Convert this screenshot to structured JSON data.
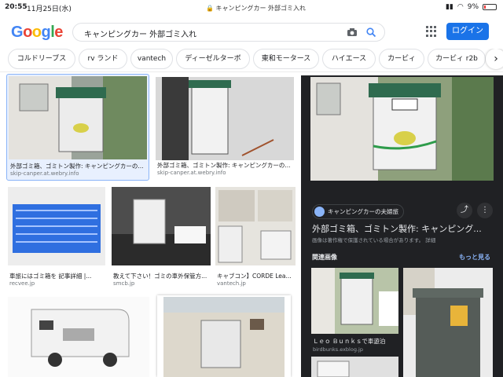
{
  "status_bar": {
    "time": "20:55",
    "date": "11月25日(水)",
    "url": "キャンピングカー 外部ゴミ入れ",
    "battery": "9%"
  },
  "header": {
    "logo": {
      "G": "G",
      "o1": "o",
      "o2": "o",
      "g": "g",
      "l": "l",
      "e": "e"
    },
    "query": "キャンピングカー 外部ゴミ入れ",
    "login": "ログイン"
  },
  "chips": [
    "コルドリーブス",
    "rv ランド",
    "vantech",
    "ディーゼルターボ",
    "東和モータース",
    "ハイエース",
    "カービィ",
    "カービィ r2b"
  ],
  "results": [
    {
      "caption": "外部ゴミ箱、ゴミトン製作: キャンピングカーの...",
      "source": "skip-canper.at.webry.info"
    },
    {
      "caption": "外部ゴミ箱、ゴミトン製作: キャンピングカーの...",
      "source": "skip-canper.at.webry.info"
    },
    {
      "caption": "車旅にはゴミ箱を 記事詳細 |...",
      "source": "recvee.jp"
    },
    {
      "caption": "教えて下さい！ゴミの車外保管方...",
      "source": "smcb.jp"
    },
    {
      "caption": "キャブコン】CORDE Lea...",
      "source": "vantech.jp"
    }
  ],
  "panel": {
    "site": "キャンピングカーの夫婦旅",
    "title": "外部ゴミ箱、ゴミトン製作: キャンピング...",
    "note": "画像は著作権で保護されている場合があります。 詳細",
    "related_label": "関連画像",
    "more_label": "もっと見る",
    "related": [
      {
        "caption": "Ｌｅｏ Ｂｕｎｋｓで車遊泊",
        "source": "birdbunks.exblog.jp"
      }
    ]
  },
  "colors": {
    "blue": "#1a73e8",
    "panel_bg": "#202124",
    "link": "#8ab4f8",
    "trash_green": "#2f6b4f"
  }
}
